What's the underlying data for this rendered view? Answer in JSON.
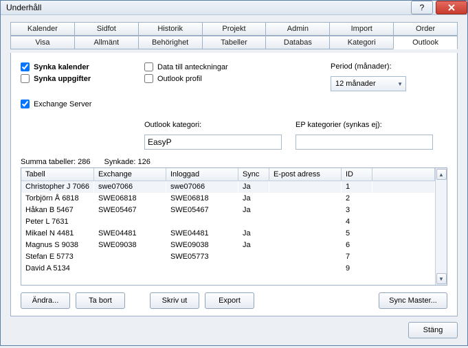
{
  "window": {
    "title": "Underhåll"
  },
  "tabs_top": [
    "Kalender",
    "Sidfot",
    "Historik",
    "Projekt",
    "Admin",
    "Import",
    "Order"
  ],
  "tabs_bottom": [
    "Visa",
    "Allmänt",
    "Behörighet",
    "Tabeller",
    "Databas",
    "Kategori",
    "Outlook"
  ],
  "active_tab": "Outlook",
  "checks": {
    "sync_calendar": "Synka kalender",
    "sync_tasks": "Synka uppgifter",
    "data_to_notes": "Data till anteckningar",
    "outlook_profile": "Outlook profil",
    "exchange_server": "Exchange Server"
  },
  "period": {
    "label": "Period (månader):",
    "value": "12 månader"
  },
  "category": {
    "outlook_label": "Outlook kategori:",
    "outlook_value": "EasyP",
    "ep_label": "EP kategorier (synkas ej):",
    "ep_value": ""
  },
  "status": {
    "sum_label": "Summa tabeller:",
    "sum_value": "286",
    "synced_label": "Synkade:",
    "synced_value": "126"
  },
  "table": {
    "headers": [
      "Tabell",
      "Exchange",
      "Inloggad",
      "Sync",
      "E-post adress",
      "ID"
    ],
    "rows": [
      {
        "t": "Christopher J 7066",
        "ex": "swe07066",
        "in": "swe07066",
        "s": "Ja",
        "ep": "",
        "id": "1"
      },
      {
        "t": "Torbjörn Å 6818",
        "ex": "SWE06818",
        "in": "SWE06818",
        "s": "Ja",
        "ep": "",
        "id": "2"
      },
      {
        "t": "Håkan B 5467",
        "ex": "SWE05467",
        "in": "SWE05467",
        "s": "Ja",
        "ep": "",
        "id": "3"
      },
      {
        "t": "Peter L 7631",
        "ex": "",
        "in": "",
        "s": "",
        "ep": "",
        "id": "4"
      },
      {
        "t": "Mikael N 4481",
        "ex": "SWE04481",
        "in": "SWE04481",
        "s": "Ja",
        "ep": "",
        "id": "5"
      },
      {
        "t": "Magnus S 9038",
        "ex": "SWE09038",
        "in": "SWE09038",
        "s": "Ja",
        "ep": "",
        "id": "6"
      },
      {
        "t": "Stefan E 5773",
        "ex": "",
        "in": "SWE05773",
        "s": "",
        "ep": "",
        "id": "7"
      },
      {
        "t": "David A 5134",
        "ex": "",
        "in": "",
        "s": "",
        "ep": "",
        "id": "9"
      }
    ]
  },
  "buttons": {
    "edit": "Ändra...",
    "delete": "Ta bort",
    "print": "Skriv ut",
    "export": "Export",
    "sync_master": "Sync Master...",
    "close": "Stäng"
  }
}
